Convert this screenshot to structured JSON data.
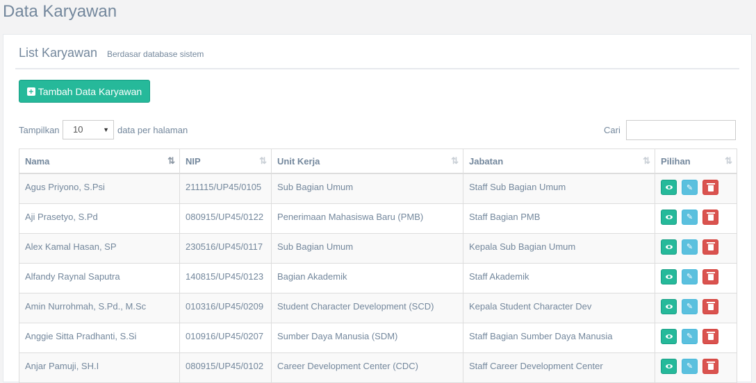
{
  "page": {
    "title": "Data Karyawan"
  },
  "panel": {
    "title": "List Karyawan",
    "subtitle": "Berdasar database sistem"
  },
  "add_button": {
    "label": "Tambah Data Karyawan",
    "icon": "plus-square-icon"
  },
  "length_control": {
    "prefix": "Tampilkan",
    "value": "10",
    "suffix": "data per halaman"
  },
  "search": {
    "label": "Cari",
    "value": ""
  },
  "table": {
    "headers": [
      "Nama",
      "NIP",
      "Unit Kerja",
      "Jabatan",
      "Pilihan"
    ],
    "rows": [
      [
        "Agus Priyono, S.Psi",
        "211115/UP45/0105",
        "Sub Bagian Umum",
        "Staff Sub Bagian Umum"
      ],
      [
        "Aji Prasetyo, S.Pd",
        "080915/UP45/0122",
        "Penerimaan Mahasiswa Baru (PMB)",
        "Staff Bagian PMB"
      ],
      [
        "Alex Kamal Hasan, SP",
        "230516/UP45/0117",
        "Sub Bagian Umum",
        "Kepala Sub Bagian Umum"
      ],
      [
        "Alfandy Raynal Saputra",
        "140815/UP45/0123",
        "Bagian Akademik",
        "Staff Akademik"
      ],
      [
        "Amin Nurrohmah, S.Pd., M.Sc",
        "010316/UP45/0209",
        "Student Character Development (SCD)",
        "Kepala Student Character Dev"
      ],
      [
        "Anggie Sitta Pradhanti, S.Si",
        "010916/UP45/0207",
        "Sumber Daya Manusia (SDM)",
        "Staff Bagian Sumber Daya Manusia"
      ],
      [
        "Anjar Pamuji, SH.I",
        "080915/UP45/0102",
        "Career Development Center (CDC)",
        "Staff Career Development Center"
      ]
    ]
  },
  "colors": {
    "primary": "#26b99a",
    "info": "#5bc0de",
    "danger": "#d9534f",
    "heading": "#73879c"
  }
}
